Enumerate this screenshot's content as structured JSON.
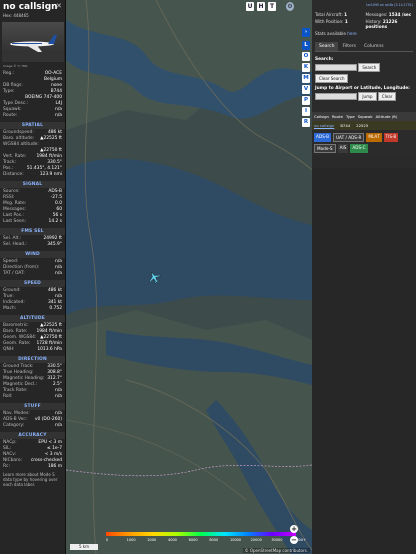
{
  "aircraft": {
    "callsign": "no callsign",
    "hex": "Hex: 448465",
    "photo_credit": "Image © Y/ YMK",
    "reg_label": "Reg.:",
    "reg": "OO-ACE",
    "country": "Belgium",
    "dbflags_label": "DB flags:",
    "dbflags": "none",
    "type_label": "Type:",
    "type": "B744",
    "type_full": "BOEING 747-400",
    "typedesc_label": "Type Desc.:",
    "typedesc": "L4J",
    "squawk_label": "Squawk:",
    "squawk": "n/a",
    "route_label": "Route:",
    "route": "n/a"
  },
  "sections": {
    "spatial": "SPATIAL",
    "signal": "SIGNAL",
    "fms": "FMS SEL",
    "wind": "WIND",
    "speed": "SPEED",
    "altitude": "ALTITUDE",
    "direction": "DIRECTION",
    "stuff": "STUFF",
    "accuracy": "ACCURACY"
  },
  "spatial_rows": [
    {
      "k": "Groundspeed:",
      "v": "486 kt"
    },
    {
      "k": "Baro. altitude:",
      "v": "▲22525 ft"
    },
    {
      "k": "WGS84 altitude:",
      "v": ""
    },
    {
      "k": "",
      "v": "▲22750 ft"
    },
    {
      "k": "Vert. Rate:",
      "v": "1984 ft/min"
    },
    {
      "k": "Track:",
      "v": "330.5°"
    },
    {
      "k": "Pos.:",
      "v": "51.435°, 4.121°"
    },
    {
      "k": "Distance:",
      "v": "123.9 nmi"
    }
  ],
  "signal_rows": [
    {
      "k": "Source:",
      "v": "ADS-B"
    },
    {
      "k": "RSSI:",
      "v": "-27.5"
    },
    {
      "k": "Msg. Rate:",
      "v": "0.0"
    },
    {
      "k": "Messages:",
      "v": "60"
    },
    {
      "k": "Last Pos.:",
      "v": "56 s"
    },
    {
      "k": "Last Seen:",
      "v": "14.2 s"
    }
  ],
  "fms_rows": [
    {
      "k": "Sel. Alt.:",
      "v": "24992 ft"
    },
    {
      "k": "Sel. Head.:",
      "v": "345.9°"
    }
  ],
  "wind_rows": [
    {
      "k": "Speed:",
      "v": "n/a"
    },
    {
      "k": "Direction (from):",
      "v": "n/a"
    },
    {
      "k": "TAT / OAT:",
      "v": "n/a"
    }
  ],
  "speed_rows": [
    {
      "k": "Ground:",
      "v": "486 kt"
    },
    {
      "k": "True:",
      "v": "n/a"
    },
    {
      "k": "Indicated:",
      "v": "341 kt"
    },
    {
      "k": "Mach:",
      "v": "0.752"
    }
  ],
  "altitude_rows": [
    {
      "k": "Barometric:",
      "v": "▲22525 ft"
    },
    {
      "k": "Baro. Rate:",
      "v": "1984 ft/min"
    },
    {
      "k": "Geom. WGS84:",
      "v": "▲22750 ft"
    },
    {
      "k": "Geom. Rate:",
      "v": "1728 ft/min"
    },
    {
      "k": "QNH:",
      "v": "1013.6 hPa"
    }
  ],
  "direction_rows": [
    {
      "k": "Ground Track:",
      "v": "330.5°"
    },
    {
      "k": "True Heading:",
      "v": "308.8°"
    },
    {
      "k": "Magnetic Heading:",
      "v": "312.7°"
    },
    {
      "k": "Magnetic Decl.:",
      "v": "2.5°"
    },
    {
      "k": "Track Rate:",
      "v": "n/a"
    },
    {
      "k": "Roll:",
      "v": "n/a"
    }
  ],
  "stuff_rows": [
    {
      "k": "Nav. Modes:",
      "v": "n/a"
    },
    {
      "k": "ADS-B Ver.:",
      "v": "v0 (DO-260)"
    },
    {
      "k": "Category:",
      "v": "n/a"
    }
  ],
  "accuracy_rows": [
    {
      "k": "NACp:",
      "v": "EPU < 3 m"
    },
    {
      "k": "SIL:",
      "v": "≤ 1e-7"
    },
    {
      "k": "NACv:",
      "v": "< 3 m/s"
    },
    {
      "k": "NICbaro:",
      "v": "cross-checked"
    },
    {
      "k": "Rc:",
      "v": "186 m"
    }
  ],
  "footer_note": "Learn more about Mode S data type by hovering over each data label.",
  "map": {
    "top_buttons": [
      "U",
      "H",
      "T"
    ],
    "side_buttons": [
      "L",
      "O",
      "K",
      "M",
      "V",
      "P",
      "I",
      "R"
    ],
    "scale": "5 km",
    "colorbar_labels": [
      "0",
      "1000",
      "2000",
      "4000",
      "6000",
      "8000",
      "10000",
      "20000",
      "30000",
      "40000+"
    ],
    "zoom_in": "+",
    "zoom_out": "−",
    "attribution": "© OpenStreetMap contributors."
  },
  "stats": {
    "link": "tar1090 on rpi4b (3.14.1751)",
    "total_label": "Total Aircraft:",
    "total": "1",
    "messages_label": "Messages:",
    "messages": "1534 /sec",
    "withpos_label": "With Position:",
    "withpos": "1",
    "history_label": "History:",
    "history": "21226 positions",
    "stats_label": "Stats available",
    "stats_link": "here"
  },
  "tabs": [
    "Search",
    "Filters",
    "Columns"
  ],
  "search": {
    "label": "Search:",
    "button": "Search",
    "clear": "Clear Search",
    "jump_label": "Jump to Airport or Latitude, Longitude:",
    "jump_button": "Jump",
    "clear2": "Clear"
  },
  "table": {
    "headers": [
      "Callsign",
      "Route",
      "Type",
      "Squawk",
      "Altitude (ft)"
    ],
    "row": [
      "no callsign",
      "",
      "B744",
      "",
      "22525"
    ]
  },
  "source_filters": [
    "ADS-B",
    "UAT / ADS-R",
    "MLAT",
    "TIS-B",
    "Mode-S",
    "AIS",
    "ADS-C"
  ]
}
